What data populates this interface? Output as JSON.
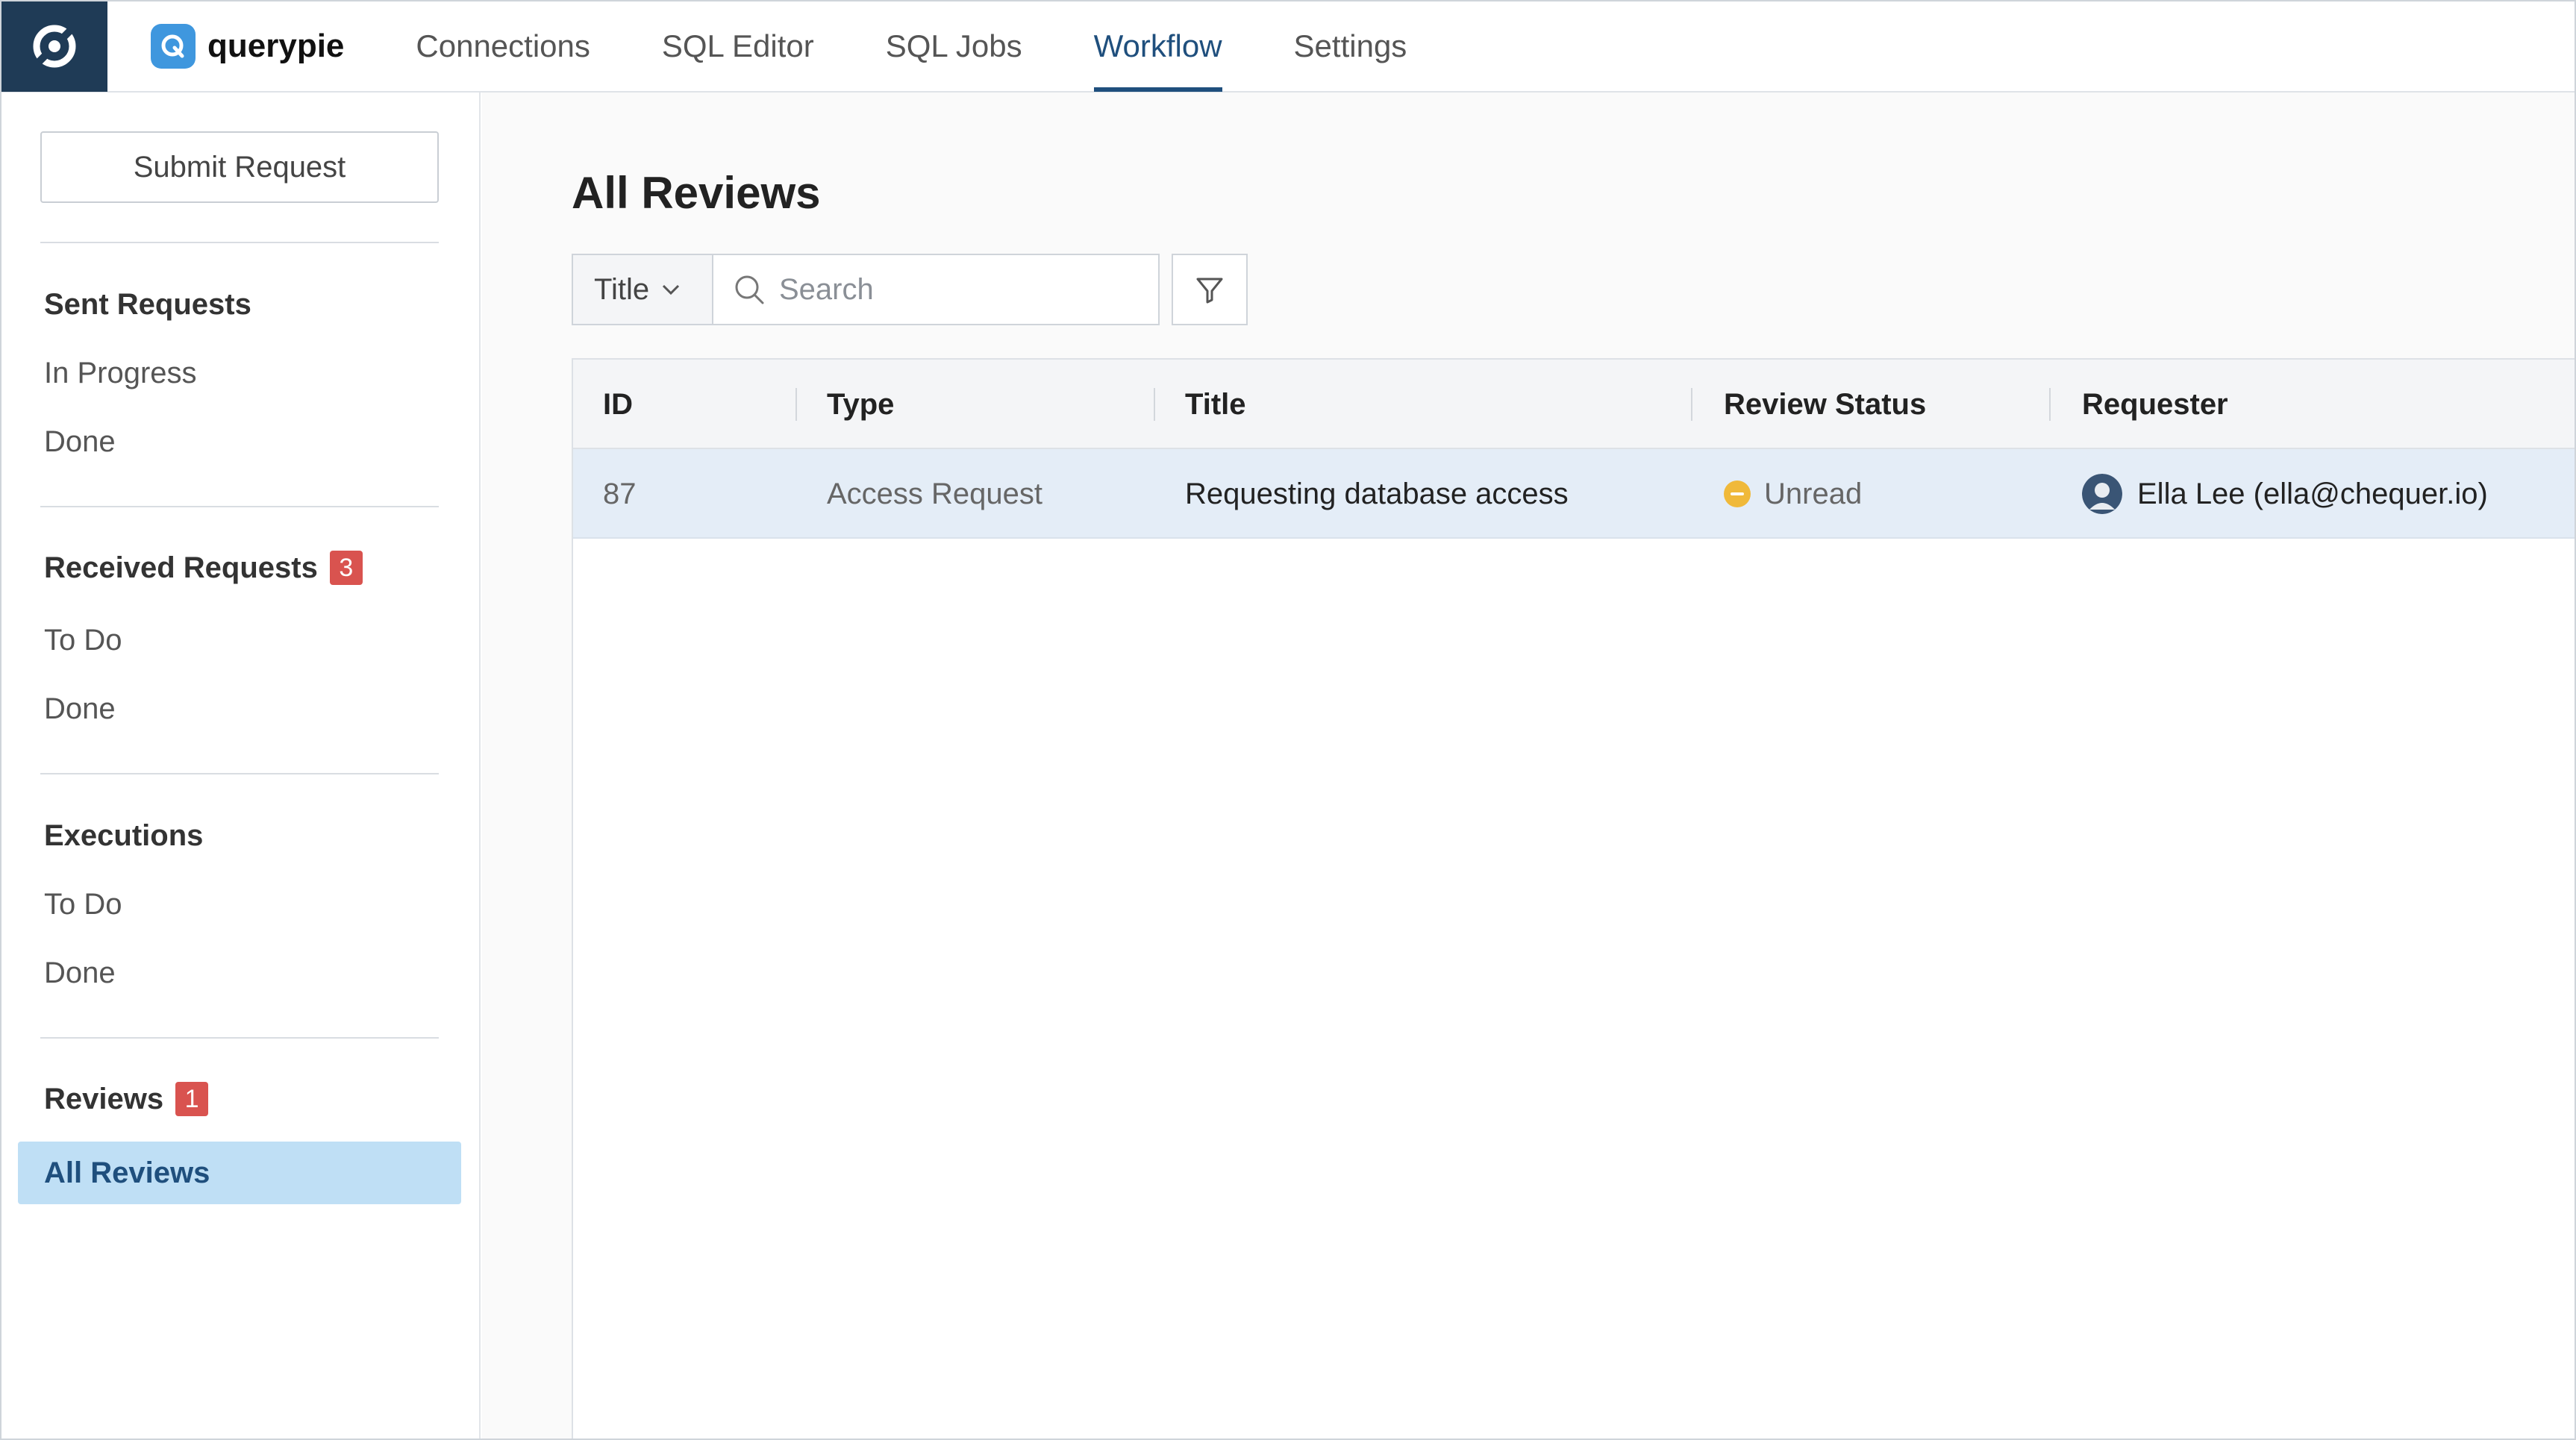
{
  "brand": {
    "name": "querypie"
  },
  "nav": {
    "tabs": [
      {
        "label": "Connections"
      },
      {
        "label": "SQL Editor"
      },
      {
        "label": "SQL Jobs"
      },
      {
        "label": "Workflow"
      },
      {
        "label": "Settings"
      }
    ],
    "active": "Workflow"
  },
  "sidebar": {
    "submit_label": "Submit Request",
    "sections": [
      {
        "title": "Sent Requests",
        "items": [
          "In Progress",
          "Done"
        ]
      },
      {
        "title": "Received Requests",
        "badge": "3",
        "items": [
          "To Do",
          "Done"
        ]
      },
      {
        "title": "Executions",
        "items": [
          "To Do",
          "Done"
        ]
      },
      {
        "title": "Reviews",
        "badge": "1",
        "items": [
          "All Reviews"
        ]
      }
    ],
    "active_item": "All Reviews"
  },
  "main": {
    "title": "All Reviews",
    "search": {
      "field": "Title",
      "placeholder": "Search",
      "value": ""
    },
    "table": {
      "columns": [
        "ID",
        "Type",
        "Title",
        "Review Status",
        "Requester"
      ],
      "rows": [
        {
          "id": "87",
          "type": "Access Request",
          "title": "Requesting database access",
          "status": "Unread",
          "requester": "Ella Lee (ella@chequer.io)"
        }
      ]
    }
  },
  "colors": {
    "app_logo_bg": "#1f3b56",
    "brand_badge": "#3f97de",
    "active_tab": "#1f4f7d",
    "badge": "#d9534f",
    "sidebar_active_bg": "#bfdff5",
    "row_selected_bg": "#e4edf7",
    "status_unread": "#f0b93a"
  },
  "icons": {
    "app_logo": "querypie-app-icon",
    "brand": "querypie-q-icon",
    "field_select": "chevron-down-icon",
    "search": "search-icon",
    "filter": "filter-icon",
    "status": "minus-circle-icon",
    "requester": "avatar-icon"
  }
}
